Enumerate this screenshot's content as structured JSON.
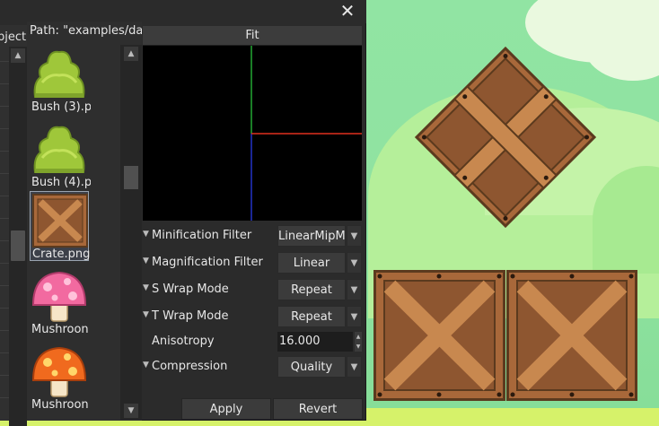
{
  "window": {
    "close_icon": "close-icon",
    "close_glyph": "✕"
  },
  "left_panel": {
    "label": "bject"
  },
  "file_browser": {
    "path": "Path: \"examples/dat",
    "items": [
      {
        "name": "Bush (3).p",
        "icon": "bush-icon",
        "selected": false
      },
      {
        "name": "Bush (4).p",
        "icon": "bush-icon",
        "selected": false
      },
      {
        "name": "Crate.png",
        "icon": "crate-icon",
        "selected": true
      },
      {
        "name": "Mushroon",
        "icon": "mushroom-pink-icon",
        "selected": false
      },
      {
        "name": "Mushroon",
        "icon": "mushroom-orange-icon",
        "selected": false
      }
    ]
  },
  "preview": {
    "header": "Fit"
  },
  "properties": {
    "minification_filter": {
      "label": "Minification Filter",
      "value": "LinearMipM"
    },
    "magnification_filter": {
      "label": "Magnification Filter",
      "value": "Linear"
    },
    "s_wrap_mode": {
      "label": "S Wrap Mode",
      "value": "Repeat"
    },
    "t_wrap_mode": {
      "label": "T Wrap Mode",
      "value": "Repeat"
    },
    "anisotropy": {
      "label": "Anisotropy",
      "value": "16.000"
    },
    "compression": {
      "label": "Compression",
      "value": "Quality"
    }
  },
  "buttons": {
    "apply": "Apply",
    "revert": "Revert"
  },
  "glyphs": {
    "expander": "▼",
    "dropdown": "▼",
    "scroll_up": "▲",
    "scroll_down": "▼"
  },
  "colors": {
    "panel": "#2b2b2b",
    "axis_x": "#e0301e",
    "axis_y": "#22a832",
    "axis_z": "#2233c8",
    "sky": "#91e4a3"
  }
}
